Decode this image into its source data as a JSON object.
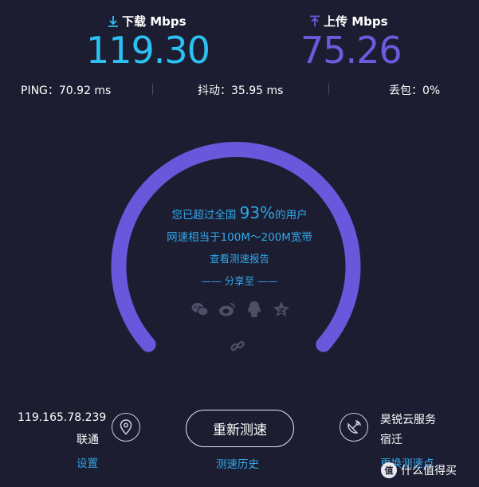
{
  "download": {
    "label": "下载 Mbps",
    "value": "119.30",
    "icon": "download-arrow-icon",
    "color": "#2cc1f3"
  },
  "upload": {
    "label": "上传 Mbps",
    "value": "75.26",
    "icon": "upload-arrow-icon",
    "color": "#6f59de"
  },
  "stats": {
    "ping": "PING：70.92 ms",
    "jitter": "抖动：35.95 ms",
    "loss": "丢包：0%"
  },
  "gauge": {
    "color": "#6a57dc",
    "summary_prefix": "您已超过全国",
    "summary_percent": "93%",
    "summary_suffix": "的用户",
    "range_text": "网速相当于100M～200M宽带",
    "report_link": "查看测速报告",
    "share_label": "—— 分享至 ——",
    "share_icons": [
      "wechat-icon",
      "weibo-icon",
      "qq-icon",
      "qzone-icon"
    ],
    "link_icon": "link-icon"
  },
  "client": {
    "ip": "119.165.78.239",
    "isp": "联通",
    "settings_link": "设置",
    "icon": "location-pin-icon"
  },
  "retest_button": "重新测速",
  "history_link": "测速历史",
  "server": {
    "name": "昊锐云服务",
    "location": "宿迁",
    "change_link": "更换测速点",
    "icon": "satellite-dish-icon"
  },
  "watermark": "值 什么值得买"
}
